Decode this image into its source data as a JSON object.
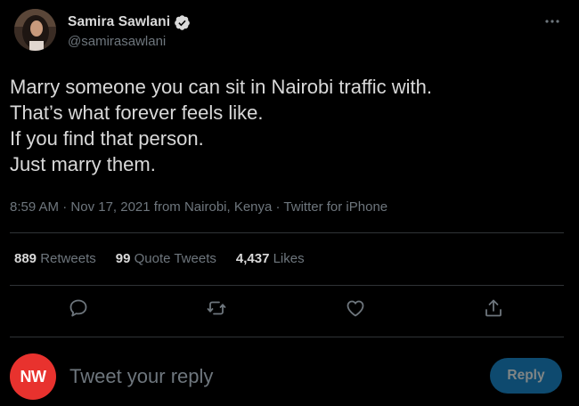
{
  "author": {
    "name": "Samira Sawlani",
    "handle": "@samirasawlani",
    "verified": true,
    "avatar_icon": "profile-photo"
  },
  "tweet": {
    "lines": [
      "Marry someone you can sit in Nairobi traffic with.",
      "That’s what forever feels like.",
      "If you find that person.",
      "Just marry them."
    ]
  },
  "meta": {
    "time": "8:59 AM",
    "separator": " · ",
    "date": "Nov 17, 2021",
    "location_prefix": " from ",
    "location": "Nairobi, Kenya",
    "source": "Twitter for iPhone"
  },
  "stats": {
    "retweets": {
      "count": "889",
      "label": "Retweets"
    },
    "quotes": {
      "count": "99",
      "label": "Quote Tweets"
    },
    "likes": {
      "count": "4,437",
      "label": "Likes"
    }
  },
  "actions": {
    "reply_icon": "comment-icon",
    "retweet_icon": "retweet-icon",
    "like_icon": "heart-icon",
    "share_icon": "share-icon"
  },
  "composer": {
    "avatar_text": "NW",
    "placeholder": "Tweet your reply",
    "button_label": "Reply"
  },
  "colors": {
    "background": "#000000",
    "text": "#d9d9d9",
    "muted": "#6e767d",
    "divider": "#2f3336",
    "verified": "#d9d9d9",
    "reply_button_bg": "#0e4a6f",
    "reply_avatar_bg": "#e8322e"
  }
}
